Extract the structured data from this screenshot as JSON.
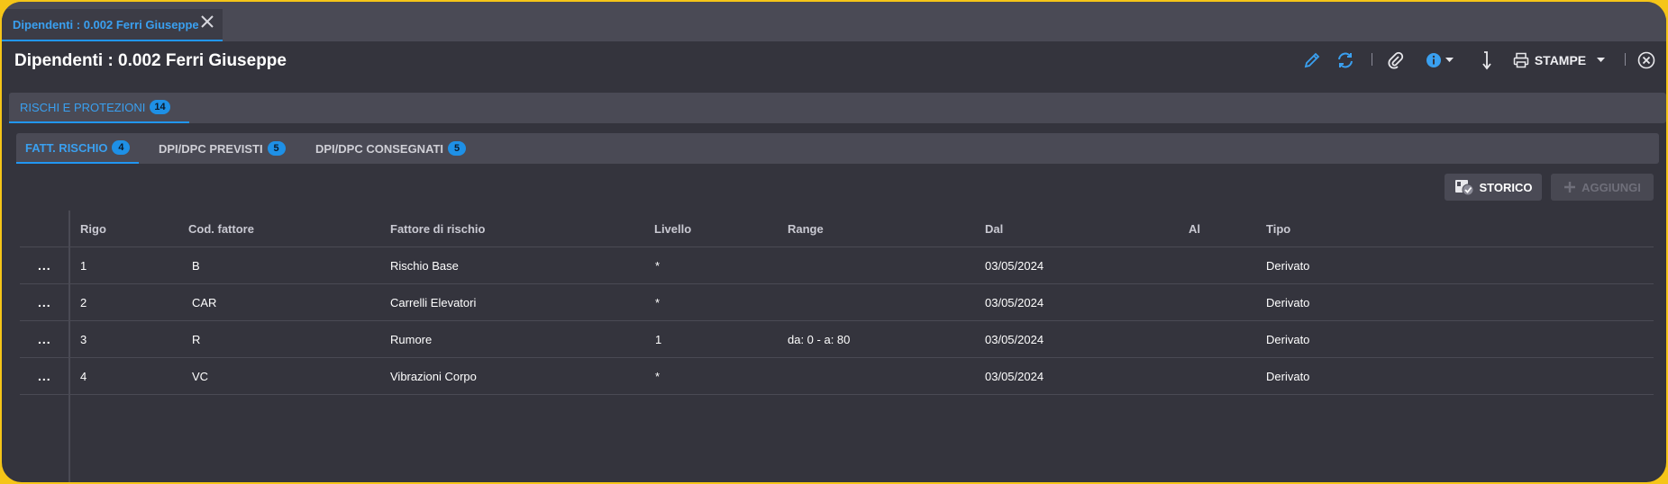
{
  "doc_tab": {
    "title": "Dipendenti : 0.002 Ferri Giuseppe"
  },
  "header": {
    "title": "Dipendenti : 0.002 Ferri Giuseppe",
    "print_label": "STAMPE"
  },
  "section_tab": {
    "label": "RISCHI E PROTEZIONI",
    "count": "14"
  },
  "subtabs": [
    {
      "label": "FATT. RISCHIO",
      "count": "4"
    },
    {
      "label": "DPI/DPC PREVISTI",
      "count": "5"
    },
    {
      "label": "DPI/DPC CONSEGNATI",
      "count": "5"
    }
  ],
  "actions": {
    "storico": "STORICO",
    "aggiungi": "AGGIUNGI"
  },
  "table": {
    "columns": [
      "Rigo",
      "Cod. fattore",
      "Fattore di rischio",
      "Livello",
      "Range",
      "Dal",
      "Al",
      "Tipo"
    ],
    "row_menu": "...",
    "rows": [
      [
        "1",
        "B",
        "Rischio Base",
        "*",
        "",
        "03/05/2024",
        "",
        "Derivato"
      ],
      [
        "2",
        "CAR",
        "Carrelli Elevatori",
        "*",
        "",
        "03/05/2024",
        "",
        "Derivato"
      ],
      [
        "3",
        "R",
        "Rumore",
        "1",
        "da: 0 - a: 80",
        "03/05/2024",
        "",
        "Derivato"
      ],
      [
        "4",
        "VC",
        "Vibrazioni Corpo",
        "*",
        "",
        "03/05/2024",
        "",
        "Derivato"
      ]
    ]
  },
  "colors": {
    "accent": "#2196f3",
    "background": "#34343d",
    "frame": "#f5c518"
  }
}
